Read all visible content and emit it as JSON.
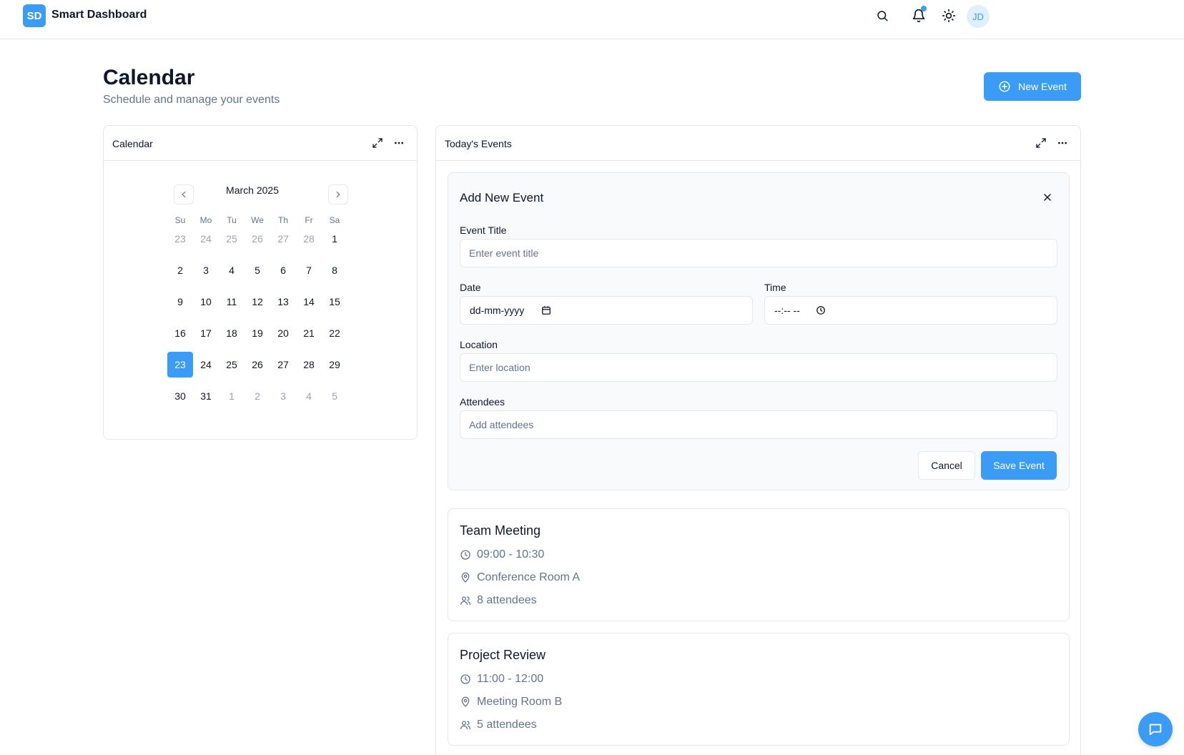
{
  "app": {
    "logo": "SD",
    "title": "Smart Dashboard"
  },
  "topbar": {
    "icons": [
      "search-icon",
      "bell-icon",
      "sun-icon"
    ],
    "avatar_initials": "JD",
    "accent": "#3b9cf5"
  },
  "header": {
    "title": "Calendar",
    "subtitle": "Schedule and manage your events",
    "new_event_label": "New Event"
  },
  "calendar_card": {
    "title": "Calendar",
    "month_label": "March 2025",
    "weekdays": [
      "Su",
      "Mo",
      "Tu",
      "We",
      "Th",
      "Fr",
      "Sa"
    ],
    "weeks": [
      [
        {
          "d": "23",
          "muted": true
        },
        {
          "d": "24",
          "muted": true
        },
        {
          "d": "25",
          "muted": true
        },
        {
          "d": "26",
          "muted": true
        },
        {
          "d": "27",
          "muted": true
        },
        {
          "d": "28",
          "muted": true
        },
        {
          "d": "1",
          "muted": false
        }
      ],
      [
        {
          "d": "2",
          "muted": false
        },
        {
          "d": "3",
          "muted": false
        },
        {
          "d": "4",
          "muted": false
        },
        {
          "d": "5",
          "muted": false
        },
        {
          "d": "6",
          "muted": false
        },
        {
          "d": "7",
          "muted": false
        },
        {
          "d": "8",
          "muted": false
        }
      ],
      [
        {
          "d": "9",
          "muted": false
        },
        {
          "d": "10",
          "muted": false
        },
        {
          "d": "11",
          "muted": false
        },
        {
          "d": "12",
          "muted": false
        },
        {
          "d": "13",
          "muted": false
        },
        {
          "d": "14",
          "muted": false
        },
        {
          "d": "15",
          "muted": false
        }
      ],
      [
        {
          "d": "16",
          "muted": false
        },
        {
          "d": "17",
          "muted": false
        },
        {
          "d": "18",
          "muted": false
        },
        {
          "d": "19",
          "muted": false
        },
        {
          "d": "20",
          "muted": false
        },
        {
          "d": "21",
          "muted": false
        },
        {
          "d": "22",
          "muted": false
        }
      ],
      [
        {
          "d": "23",
          "muted": false,
          "selected": true
        },
        {
          "d": "24",
          "muted": false
        },
        {
          "d": "25",
          "muted": false
        },
        {
          "d": "26",
          "muted": false
        },
        {
          "d": "27",
          "muted": false
        },
        {
          "d": "28",
          "muted": false
        },
        {
          "d": "29",
          "muted": false
        }
      ],
      [
        {
          "d": "30",
          "muted": false
        },
        {
          "d": "31",
          "muted": false
        },
        {
          "d": "1",
          "muted": true
        },
        {
          "d": "2",
          "muted": true
        },
        {
          "d": "3",
          "muted": true
        },
        {
          "d": "4",
          "muted": true
        },
        {
          "d": "5",
          "muted": true
        }
      ]
    ]
  },
  "events_card": {
    "title": "Today's Events",
    "form": {
      "title": "Add New Event",
      "event_title_label": "Event Title",
      "event_title_placeholder": "Enter event title",
      "date_label": "Date",
      "date_placeholder": "dd-mm-yyyy",
      "time_label": "Time",
      "time_placeholder": "--:-- --",
      "location_label": "Location",
      "location_placeholder": "Enter location",
      "attendees_label": "Attendees",
      "attendees_placeholder": "Add attendees",
      "cancel_label": "Cancel",
      "save_label": "Save Event"
    },
    "events": [
      {
        "title": "Team Meeting",
        "time": "09:00 - 10:30",
        "location": "Conference Room A",
        "attendees": "8 attendees"
      },
      {
        "title": "Project Review",
        "time": "11:00 - 12:00",
        "location": "Meeting Room B",
        "attendees": "5 attendees"
      }
    ]
  }
}
